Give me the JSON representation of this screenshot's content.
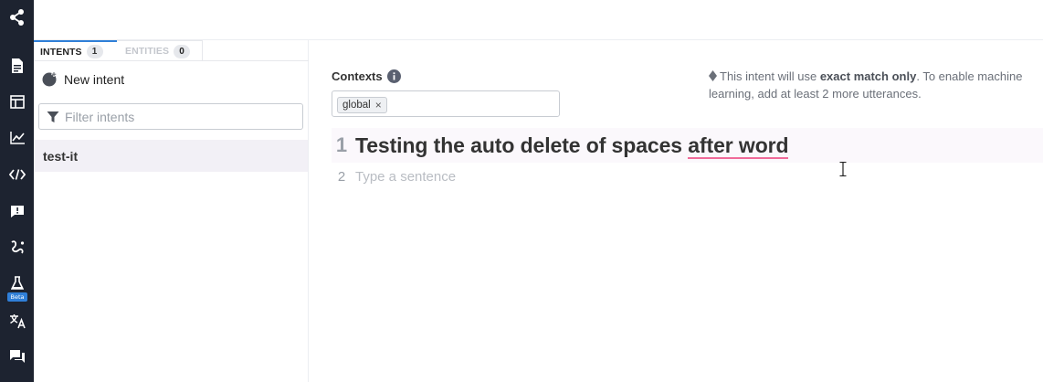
{
  "sidebar": {
    "icons": [
      "share-icon",
      "document-icon",
      "layout-icon",
      "chart-line-icon",
      "code-icon",
      "chat-alert-icon",
      "route-icon",
      "flask-icon",
      "translate-icon",
      "forum-icon"
    ],
    "beta_label": "Beta"
  },
  "tabs": {
    "intents_label": "INTENTS",
    "intents_count": "1",
    "entities_label": "ENTITIES",
    "entities_count": "0"
  },
  "new_intent_label": "New intent",
  "filter": {
    "placeholder": "Filter intents"
  },
  "intent_list": [
    {
      "label": "test-it",
      "selected": true
    }
  ],
  "contexts": {
    "label": "Contexts",
    "chips": [
      {
        "label": "global",
        "remove_symbol": "×"
      }
    ]
  },
  "notice": {
    "prefix": "This intent will use ",
    "bold": "exact match only",
    "suffix": ". To enable machine learning, add at least 2 more utterances."
  },
  "utterances": [
    {
      "number": "1",
      "text_plain": "Testing the auto delete of spaces ",
      "text_underlined": "after word"
    },
    {
      "number": "2",
      "placeholder": "Type a sentence"
    }
  ],
  "colors": {
    "rail_bg": "#1d2330",
    "accent_blue": "#2f7fd8",
    "underline_pink": "#f06a99",
    "selected_row_bg": "#f2f0f6"
  }
}
